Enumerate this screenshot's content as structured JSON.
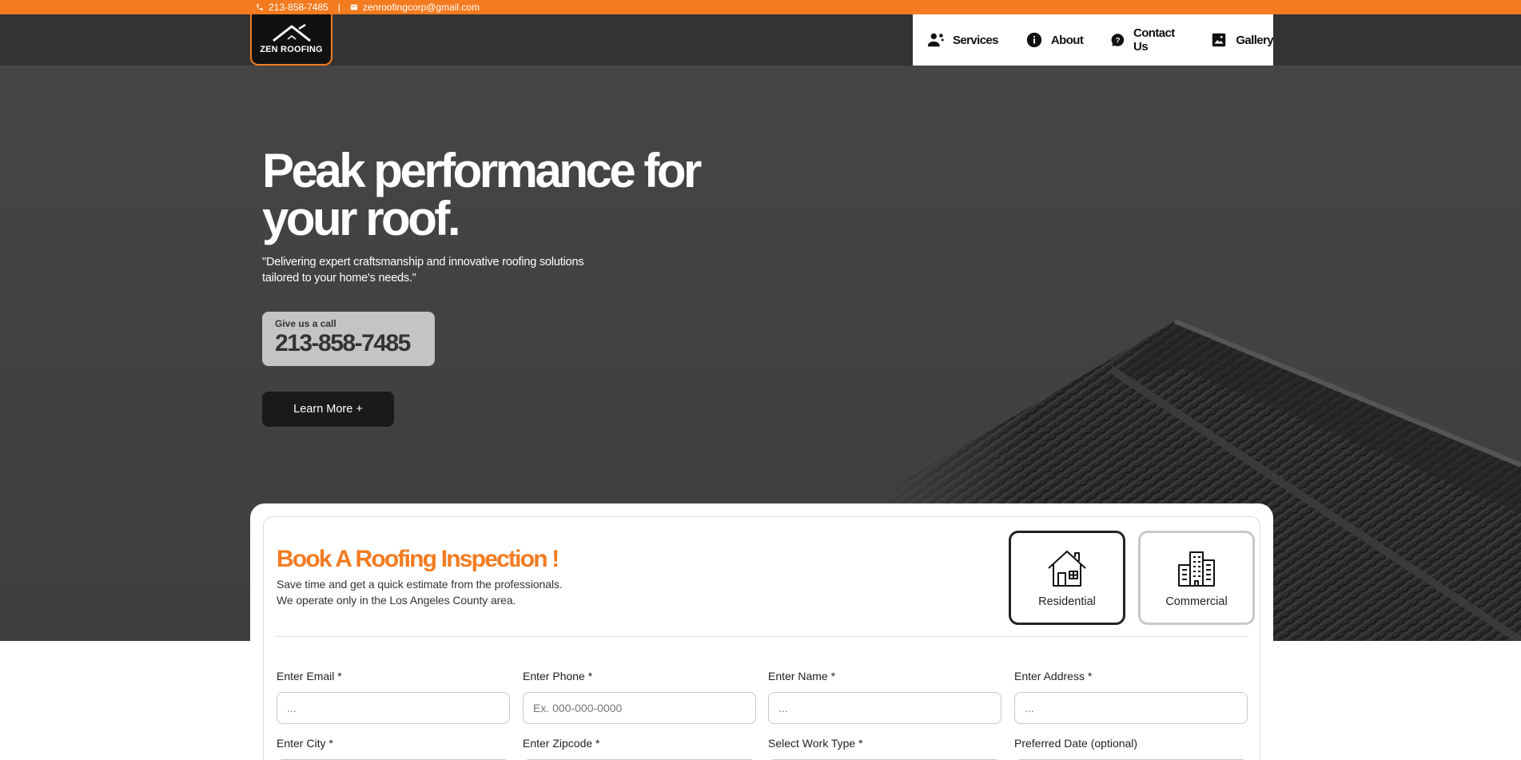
{
  "topbar": {
    "phone": "213-858-7485",
    "separator": "|",
    "email": "zenroofingcorp@gmail.com"
  },
  "header": {
    "logo_text": "ZEN ROOFING",
    "nav": [
      {
        "label": "Services",
        "icon": "services-icon"
      },
      {
        "label": "About",
        "icon": "info-icon"
      },
      {
        "label": "Contact Us",
        "icon": "help-icon"
      },
      {
        "label": "Gallery",
        "icon": "image-icon"
      }
    ]
  },
  "hero": {
    "title": "Peak performance for your roof.",
    "subtitle": "\"Delivering expert craftsmanship and innovative roofing solutions tailored to your home's needs.\"",
    "call_label": "Give us a call",
    "call_number": "213-858-7485",
    "learn_more": "Learn More +"
  },
  "booking": {
    "title": "Book A Roofing Inspection !",
    "subtitle_line1": "Save time and get a quick estimate from the professionals.",
    "subtitle_line2": "We operate only in the Los Angeles County area.",
    "options": [
      {
        "label": "Residential",
        "icon": "house-icon",
        "selected": true
      },
      {
        "label": "Commercial",
        "icon": "building-icon",
        "selected": false
      }
    ],
    "fields": [
      {
        "label": "Enter Email *",
        "placeholder": "...",
        "value": ""
      },
      {
        "label": "Enter Phone *",
        "placeholder": "Ex. 000-000-0000",
        "value": ""
      },
      {
        "label": "Enter Name *",
        "placeholder": "...",
        "value": ""
      },
      {
        "label": "Enter Address *",
        "placeholder": "...",
        "value": ""
      },
      {
        "label": "Enter City *",
        "placeholder": "",
        "value": ""
      },
      {
        "label": "Enter Zipcode *",
        "placeholder": "",
        "value": ""
      },
      {
        "label": "Select Work Type *",
        "placeholder": "",
        "value": ""
      },
      {
        "label": "Preferred Date (optional)",
        "placeholder": "",
        "value": ""
      }
    ]
  },
  "colors": {
    "accent": "#f47b20",
    "header_bg": "#333333",
    "hero_bg": "#444444",
    "button_dark": "#1a1a1a"
  }
}
